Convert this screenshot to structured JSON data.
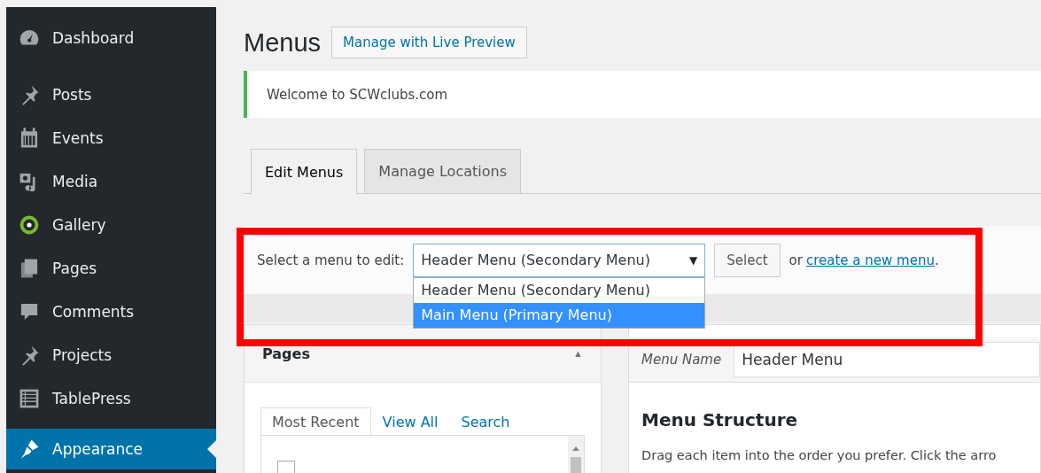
{
  "sidebar": {
    "items": [
      {
        "label": "Dashboard",
        "selected": false
      },
      {
        "label": "Posts",
        "selected": false
      },
      {
        "label": "Events",
        "selected": false
      },
      {
        "label": "Media",
        "selected": false
      },
      {
        "label": "Gallery",
        "selected": false
      },
      {
        "label": "Pages",
        "selected": false
      },
      {
        "label": "Comments",
        "selected": false
      },
      {
        "label": "Projects",
        "selected": false
      },
      {
        "label": "TablePress",
        "selected": false
      },
      {
        "label": "Appearance",
        "selected": true
      }
    ]
  },
  "page_title": "Menus",
  "live_preview_button": "Manage with Live Preview",
  "notice": "Welcome to SCWclubs.com",
  "tabs": [
    {
      "label": "Edit Menus",
      "selected": true
    },
    {
      "label": "Manage Locations",
      "selected": false
    }
  ],
  "menu_select": {
    "label": "Select a menu to edit:",
    "value": "Header Menu (Secondary Menu)",
    "arrow": "▼",
    "expanded": true,
    "options": [
      {
        "label": "Header Menu (Secondary Menu)",
        "highlighted": false
      },
      {
        "label": "Main Menu (Primary Menu)",
        "highlighted": true
      }
    ],
    "button": "Select",
    "or_text": "or",
    "link": "create a new menu",
    "after_link": "."
  },
  "pages_panel": {
    "title": "Pages",
    "collapse_arrow": "▲",
    "tabs": [
      {
        "label": "Most Recent",
        "selected": true
      },
      {
        "label": "View All",
        "selected": false
      },
      {
        "label": "Search",
        "selected": false
      }
    ],
    "rows": [
      {
        "checked": false
      }
    ]
  },
  "menu_name": {
    "label": "Menu Name",
    "value": "Header Menu"
  },
  "menu_structure": {
    "title": "Menu Structure",
    "text": "Drag each item into the order you prefer. Click the arro"
  }
}
